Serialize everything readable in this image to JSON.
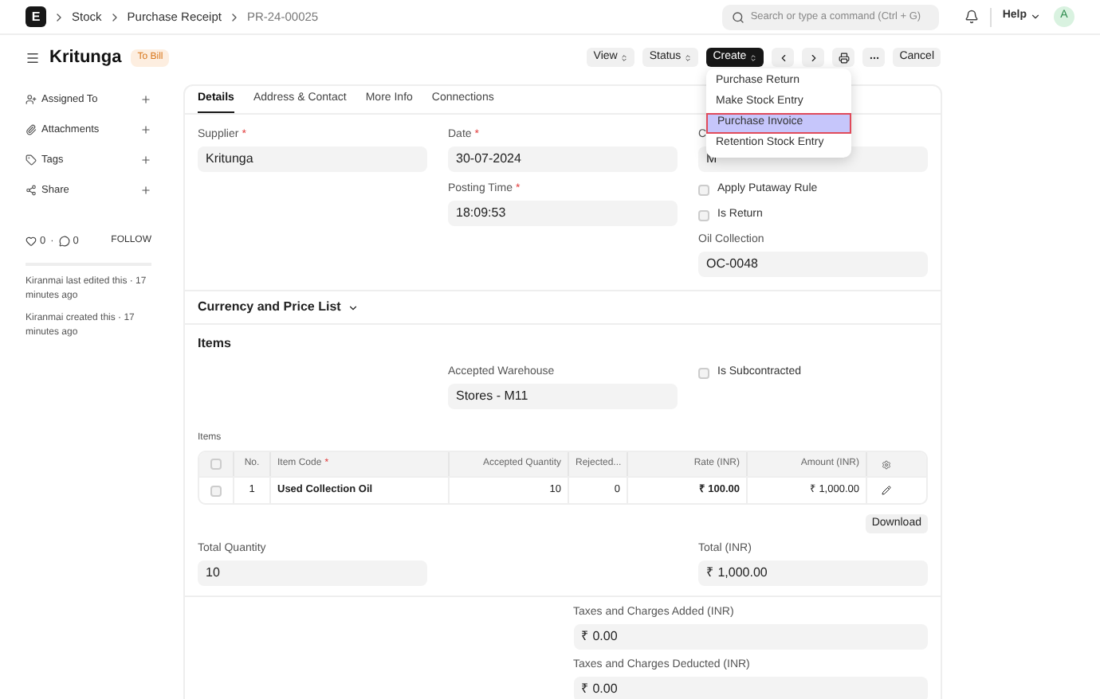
{
  "navbar": {
    "logo": "E",
    "breadcrumbs": [
      "Stock",
      "Purchase Receipt",
      "PR-24-00025"
    ],
    "search": {
      "placeholder": "Search or type a command (Ctrl + G)"
    },
    "help": "Help",
    "avatar": "A"
  },
  "header": {
    "title": "Kritunga",
    "status": "To Bill",
    "buttons": [
      "View",
      "Status"
    ],
    "primary": "Create",
    "cancel": "Cancel"
  },
  "create_menu": [
    {
      "label": "Purchase Return",
      "selected": false
    },
    {
      "label": "Make Stock Entry",
      "selected": false
    },
    {
      "label": "Purchase Invoice",
      "selected": true
    },
    {
      "label": "Retention Stock Entry",
      "selected": false
    }
  ],
  "sidebar": {
    "items": [
      "Assigned To",
      "Attachments",
      "Tags",
      "Share"
    ],
    "likes": "0",
    "separator": "·",
    "comments": "0",
    "follow": "FOLLOW",
    "activity": [
      "Kiranmai last edited this · 17 minutes ago",
      "Kiranmai created this · 17 minutes ago"
    ]
  },
  "tabs": [
    {
      "label": "Details",
      "selected": true
    },
    {
      "label": "Address & Contact",
      "selected": false
    },
    {
      "label": "More Info",
      "selected": false
    },
    {
      "label": "Connections",
      "selected": false
    }
  ],
  "details": {
    "supplier": {
      "label": "Supplier",
      "required_mark": "*",
      "value": "Kritunga"
    },
    "date": {
      "label": "Date",
      "required_mark": "*",
      "value": "30-07-2024"
    },
    "posting_time": {
      "label": "Posting Time",
      "required_mark": "*",
      "value": "18:09:53"
    },
    "column_3": {
      "label": "C",
      "value": "M"
    },
    "checks": [
      {
        "label": "Apply Putaway Rule",
        "checked": false
      },
      {
        "label": "Is Return",
        "checked": false
      }
    ],
    "oil_collection": {
      "label": "Oil Collection",
      "value": "OC-0048"
    }
  },
  "currency_section": "Currency and Price List",
  "items_section": {
    "title": "Items",
    "warehouse": {
      "label": "Accepted Warehouse",
      "value": "Stores - M11"
    },
    "subcontracted": {
      "label": "Is Subcontracted",
      "checked": false
    },
    "table_label": "Items",
    "select_all": {
      "checked": false
    },
    "columns": [
      {
        "label": "No."
      },
      {
        "label": "Item Code",
        "required_mark": "*"
      },
      {
        "label": "Accepted Quantity"
      },
      {
        "label": "Rejected..."
      },
      {
        "label": "Rate (INR)"
      },
      {
        "label": "Amount (INR)"
      }
    ],
    "rows": [
      {
        "checked": false,
        "cells": [
          "1",
          "Used Collection Oil",
          "10",
          "0",
          "₹ 100.00",
          "₹ 1,000.00"
        ]
      }
    ],
    "download": "Download",
    "total_quantity": {
      "label": "Total Quantity",
      "value": "10"
    },
    "total": {
      "label": "Total (INR)",
      "value": "₹ 1,000.00"
    }
  },
  "taxes": [
    {
      "label": "Taxes and Charges Added (INR)",
      "value": "₹ 0.00"
    },
    {
      "label": "Taxes and Charges Deducted (INR)",
      "value": "₹ 0.00"
    }
  ]
}
